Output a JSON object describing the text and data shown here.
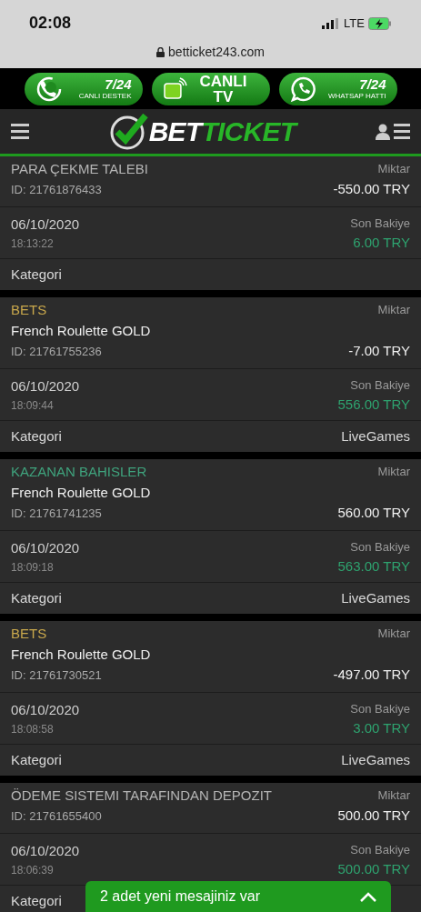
{
  "status_bar": {
    "time": "02:08",
    "network": "LTE"
  },
  "address_bar": {
    "url": "betticket243.com"
  },
  "promo_buttons": [
    {
      "kind": "support",
      "big": "7/24",
      "small": "CANLI DESTEK"
    },
    {
      "kind": "tv",
      "big": "CANLI TV"
    },
    {
      "kind": "whatsapp",
      "big": "7/24",
      "small": "WHATSAP HATTI"
    }
  ],
  "header": {
    "logo_left": "BET",
    "logo_right": "TICKET"
  },
  "transactions": [
    {
      "type": "PARA ÇEKME TALEBI",
      "color": "#b5b5b5",
      "amount_label": "Miktar",
      "id": "ID: 21761876433",
      "amount": "-550.00 TRY",
      "date": "06/10/2020",
      "time": "18:13:22",
      "balance_label": "Son Bakiye",
      "balance": "6.00 TRY",
      "category_label": "Kategori"
    },
    {
      "type": "BETS",
      "color": "#c9a84c",
      "game": "French Roulette GOLD",
      "amount_label": "Miktar",
      "id": "ID: 21761755236",
      "amount": "-7.00 TRY",
      "date": "06/10/2020",
      "time": "18:09:44",
      "balance_label": "Son Bakiye",
      "balance": "556.00 TRY",
      "category_label": "Kategori",
      "category": "LiveGames"
    },
    {
      "type": "KAZANAN BAHISLER",
      "color": "#3fa37d",
      "game": "French Roulette GOLD",
      "amount_label": "Miktar",
      "id": "ID: 21761741235",
      "amount": "560.00 TRY",
      "date": "06/10/2020",
      "time": "18:09:18",
      "balance_label": "Son Bakiye",
      "balance": "563.00 TRY",
      "category_label": "Kategori",
      "category": "LiveGames"
    },
    {
      "type": "BETS",
      "color": "#c9a84c",
      "game": "French Roulette GOLD",
      "amount_label": "Miktar",
      "id": "ID: 21761730521",
      "amount": "-497.00 TRY",
      "date": "06/10/2020",
      "time": "18:08:58",
      "balance_label": "Son Bakiye",
      "balance": "3.00 TRY",
      "category_label": "Kategori",
      "category": "LiveGames"
    },
    {
      "type": "ÖDEME SISTEMI TARAFINDAN DEPOZIT",
      "color": "#b5b5b5",
      "amount_label": "Miktar",
      "id": "ID: 21761655400",
      "amount": "500.00 TRY",
      "date": "06/10/2020",
      "time": "18:06:39",
      "balance_label": "Son Bakiye",
      "balance": "500.00 TRY",
      "category_label": "Kategori"
    }
  ],
  "message_toast": {
    "text": "2 adet yeni mesajiniz var"
  }
}
